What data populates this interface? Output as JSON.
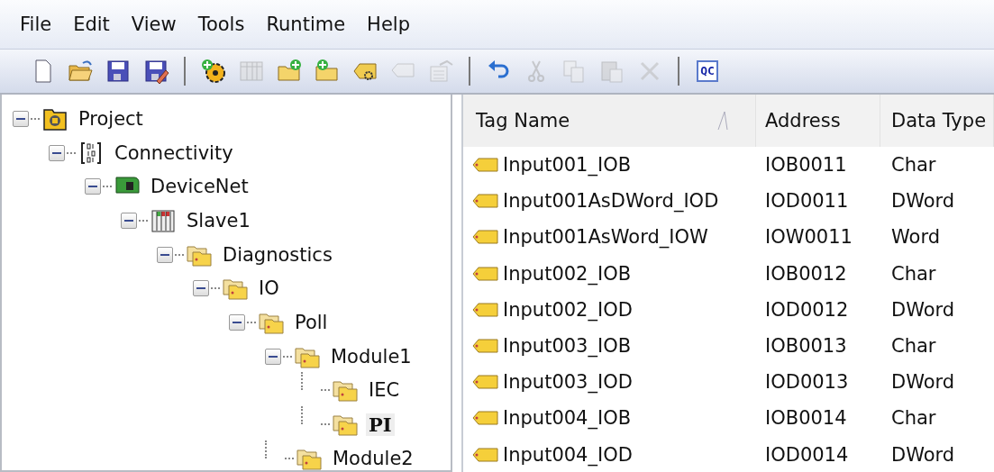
{
  "menu": [
    "File",
    "Edit",
    "View",
    "Tools",
    "Runtime",
    "Help"
  ],
  "toolbar": [
    {
      "kind": "new",
      "disabled": false
    },
    {
      "kind": "open",
      "disabled": false
    },
    {
      "kind": "save",
      "disabled": false
    },
    {
      "kind": "saveas",
      "disabled": false
    },
    {
      "kind": "sep"
    },
    {
      "kind": "gearadd",
      "disabled": false
    },
    {
      "kind": "columns",
      "disabled": true
    },
    {
      "kind": "folderadd",
      "disabled": false
    },
    {
      "kind": "folderadd2",
      "disabled": false
    },
    {
      "kind": "taggear",
      "disabled": false
    },
    {
      "kind": "tags",
      "disabled": true
    },
    {
      "kind": "props",
      "disabled": true
    },
    {
      "kind": "sep"
    },
    {
      "kind": "undo",
      "disabled": false
    },
    {
      "kind": "cut",
      "disabled": true
    },
    {
      "kind": "copy",
      "disabled": true
    },
    {
      "kind": "paste",
      "disabled": true
    },
    {
      "kind": "delete",
      "disabled": true
    },
    {
      "kind": "sep"
    },
    {
      "kind": "qc",
      "disabled": false,
      "label": "QC"
    }
  ],
  "tree": [
    {
      "label": "Project",
      "kind": "project",
      "expanded": true,
      "selected": false,
      "children": [
        {
          "label": "Connectivity",
          "kind": "connectivity",
          "expanded": true,
          "selected": false,
          "children": [
            {
              "label": "DeviceNet",
              "kind": "device",
              "expanded": true,
              "selected": false,
              "children": [
                {
                  "label": "Slave1",
                  "kind": "slave",
                  "expanded": true,
                  "selected": false,
                  "children": [
                    {
                      "label": "Diagnostics",
                      "kind": "folder",
                      "expanded": true,
                      "selected": false,
                      "children": [
                        {
                          "label": "IO",
                          "kind": "folder",
                          "expanded": true,
                          "selected": false,
                          "children": [
                            {
                              "label": "Poll",
                              "kind": "folder",
                              "expanded": true,
                              "selected": false,
                              "children": [
                                {
                                  "label": "Module1",
                                  "kind": "folder",
                                  "expanded": true,
                                  "selected": false,
                                  "children": [
                                    {
                                      "label": "IEC",
                                      "kind": "folder",
                                      "selected": false
                                    },
                                    {
                                      "label": "PI",
                                      "kind": "folder",
                                      "selected": true
                                    }
                                  ]
                                },
                                {
                                  "label": "Module2",
                                  "kind": "folder",
                                  "selected": false
                                }
                              ]
                            }
                          ]
                        }
                      ]
                    }
                  ]
                }
              ]
            }
          ]
        }
      ]
    }
  ],
  "table": {
    "columns": [
      {
        "label": "Tag Name",
        "sorted": true
      },
      {
        "label": "Address",
        "sorted": false
      },
      {
        "label": "Data Type",
        "sorted": false
      }
    ],
    "rows": [
      [
        "Input001_IOB",
        "IOB0011",
        "Char"
      ],
      [
        "Input001AsDWord_IOD",
        "IOD0011",
        "DWord"
      ],
      [
        "Input001AsWord_IOW",
        "IOW0011",
        "Word"
      ],
      [
        "Input002_IOB",
        "IOB0012",
        "Char"
      ],
      [
        "Input002_IOD",
        "IOD0012",
        "DWord"
      ],
      [
        "Input003_IOB",
        "IOB0013",
        "Char"
      ],
      [
        "Input003_IOD",
        "IOD0013",
        "DWord"
      ],
      [
        "Input004_IOB",
        "IOB0014",
        "Char"
      ],
      [
        "Input004_IOD",
        "IOD0014",
        "DWord"
      ]
    ]
  }
}
